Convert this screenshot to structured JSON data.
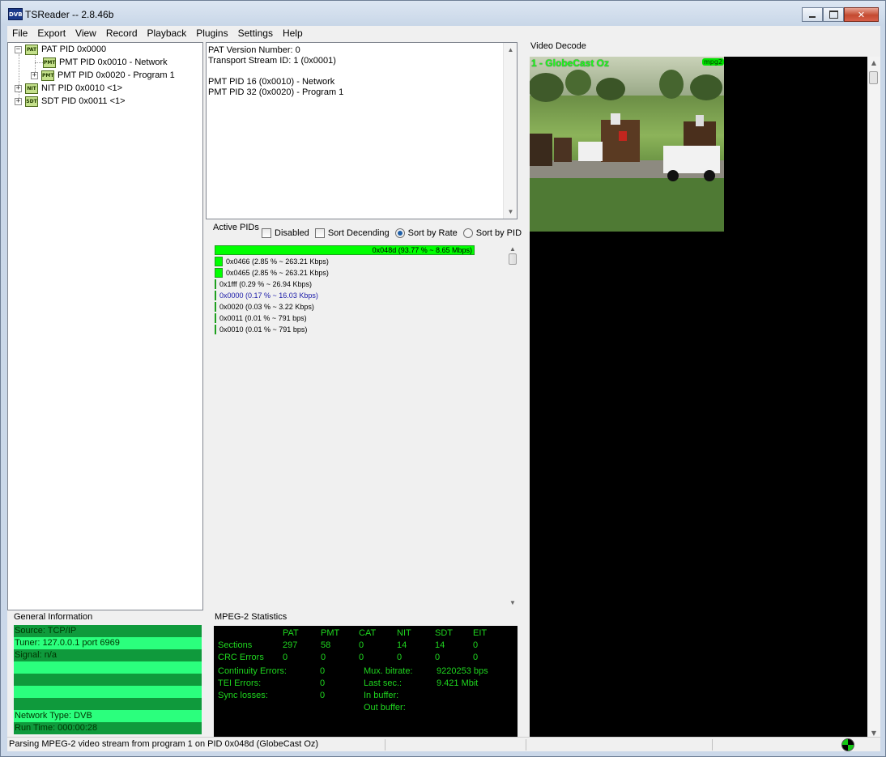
{
  "window": {
    "title": "TSReader -- 2.8.46b",
    "app_icon": "DVB"
  },
  "menu": [
    "File",
    "Export",
    "View",
    "Record",
    "Playback",
    "Plugins",
    "Settings",
    "Help"
  ],
  "tree": [
    {
      "label": "PAT PID 0x0000",
      "icon": "PAT",
      "expander": "−"
    },
    {
      "label": "PMT PID 0x0010 - Network",
      "icon": "PMT",
      "expander": ""
    },
    {
      "label": "PMT PID 0x0020 - Program 1",
      "icon": "PMT",
      "expander": "+"
    },
    {
      "label": "NIT PID 0x0010 <1>",
      "icon": "NIT",
      "expander": "+"
    },
    {
      "label": "SDT PID 0x0011 <1>",
      "icon": "SDT",
      "expander": "+"
    }
  ],
  "info": [
    "PAT Version Number: 0",
    "Transport Stream ID: 1 (0x0001)",
    "",
    "PMT PID 16 (0x0010) - Network",
    "PMT PID 32 (0x0020) - Program 1"
  ],
  "active_pids": {
    "label": "Active PIDs",
    "options": {
      "disabled": "Disabled",
      "sort_descending": "Sort Decending",
      "sort_by_rate": "Sort by Rate",
      "sort_by_pid": "Sort by PID"
    },
    "selected_sort": "Sort by Rate",
    "rows": [
      {
        "text": "0x048d (93.77 % ~ 8.65 Mbps)",
        "percent": 93.77,
        "color": "#00ff00",
        "text_color": "#000000"
      },
      {
        "text": "0x0466 (2.85 % ~ 263.21 Kbps)",
        "percent": 2.85,
        "color": "#00ff00",
        "text_color": "#000000"
      },
      {
        "text": "0x0465 (2.85 % ~ 263.21 Kbps)",
        "percent": 2.85,
        "color": "#00ff00",
        "text_color": "#000000"
      },
      {
        "text": "0x1fff (0.29 % ~ 26.94 Kbps)",
        "percent": 0.29,
        "color": "#00ff00",
        "text_color": "#000000"
      },
      {
        "text": "0x0000 (0.17 % ~ 16.03 Kbps)",
        "percent": 0.17,
        "color": "#00ff00",
        "text_color": "#1a1aa8"
      },
      {
        "text": "0x0020 (0.03 % ~ 3.22 Kbps)",
        "percent": 0.03,
        "color": "#00ff00",
        "text_color": "#000000"
      },
      {
        "text": "0x0011 (0.01 % ~ 791 bps)",
        "percent": 0.01,
        "color": "#00ff00",
        "text_color": "#000000"
      },
      {
        "text": "0x0010 (0.01 % ~ 791 bps)",
        "percent": 0.01,
        "color": "#00ff00",
        "text_color": "#000000"
      }
    ]
  },
  "general_info": {
    "label": "General Information",
    "rows": [
      "Source: TCP/IP",
      "Tuner: 127.0.0.1 port 6969",
      "Signal: n/a",
      "",
      "",
      "",
      "",
      "Network Type: DVB",
      "Run Time: 000:00:28"
    ]
  },
  "mpeg2_stats": {
    "label": "MPEG-2 Statistics",
    "columns": [
      "PAT",
      "PMT",
      "CAT",
      "NIT",
      "SDT",
      "EIT"
    ],
    "sections_label": "Sections",
    "sections": [
      "297",
      "58",
      "0",
      "14",
      "14",
      "0"
    ],
    "crc_label": "CRC Errors",
    "crc": [
      "0",
      "0",
      "0",
      "0",
      "0",
      "0"
    ],
    "continuity_label": "Continuity Errors:",
    "continuity": "0",
    "tei_label": "TEI Errors:",
    "tei": "0",
    "sync_label": "Sync losses:",
    "sync": "0",
    "mux_label": "Mux. bitrate:",
    "mux": "9220253 bps",
    "last_label": "Last sec.:",
    "last": "9.421 Mbit",
    "in_buffer_label": "In buffer:",
    "out_buffer_label": "Out buffer:"
  },
  "video": {
    "label": "Video Decode",
    "title": "1 - GlobeCast Oz",
    "codec": "mpg2"
  },
  "status": {
    "text": "Parsing MPEG-2 video stream from program 1 on PID 0x048d (GlobeCast Oz)"
  }
}
